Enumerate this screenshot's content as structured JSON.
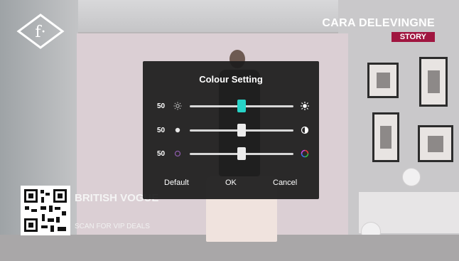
{
  "brand": {
    "logo_letter": "f·",
    "name": "CARA DELEVINGNE",
    "tag": "STORY"
  },
  "promo": {
    "title": "BRITISH VOGUE",
    "subtitle": "SCAN FOR VIP DEALS"
  },
  "dialog": {
    "title": "Colour Setting",
    "sliders": [
      {
        "name": "brightness",
        "value": "50",
        "level": 0.5,
        "left_icon": "brightness-low-icon",
        "right_icon": "brightness-high-icon",
        "active": true
      },
      {
        "name": "contrast",
        "value": "50",
        "level": 0.5,
        "left_icon": "contrast-dot-icon",
        "right_icon": "contrast-half-icon",
        "active": false
      },
      {
        "name": "saturation",
        "value": "50",
        "level": 0.5,
        "left_icon": "saturation-low-icon",
        "right_icon": "saturation-high-icon",
        "active": false
      }
    ],
    "buttons": {
      "default_label": "Default",
      "ok_label": "OK",
      "cancel_label": "Cancel"
    }
  },
  "colors": {
    "accent": "#27d3c7",
    "tag_bg": "#a01640"
  }
}
